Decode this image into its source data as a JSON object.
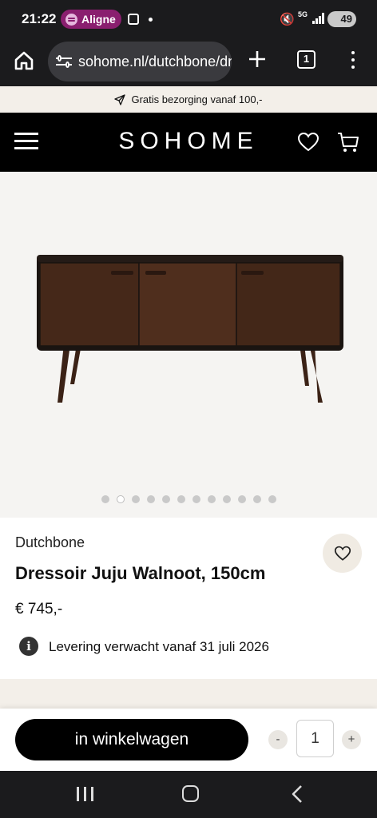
{
  "status_bar": {
    "time": "21:22",
    "spotify_label": "Aligne",
    "network": "5G",
    "battery": "49"
  },
  "browser": {
    "url": "sohome.nl/dutchbone/dressoir-juju",
    "tab_count": "1"
  },
  "promo": {
    "text": "Gratis bezorging vanaf 100,-"
  },
  "header": {
    "logo": "SOHOME"
  },
  "gallery": {
    "image_count": 12,
    "active_index": 1
  },
  "product": {
    "brand": "Dutchbone",
    "title": "Dressoir Juju Walnoot, 150cm",
    "price": "€ 745,-",
    "delivery": "Levering verwacht vanaf 31 juli 2026"
  },
  "cart": {
    "add_label": "in winkelwagen",
    "minus": "-",
    "plus": "+",
    "quantity": "1"
  },
  "colors": {
    "accent": "#000000",
    "beige": "#f3efe9",
    "wood": "#4a2a1c"
  }
}
